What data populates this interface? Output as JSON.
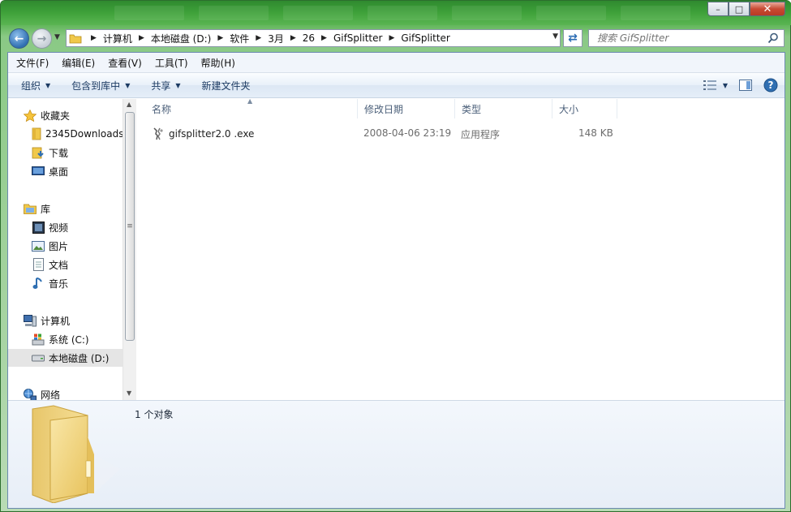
{
  "window": {
    "title_tabs": [
      "",
      "",
      "",
      "",
      "",
      "",
      ""
    ],
    "controls": {
      "minimize": "–",
      "maximize": "□",
      "close": "✕"
    }
  },
  "nav": {
    "back_icon": "back-arrow-icon",
    "forward_icon": "forward-arrow-icon",
    "breadcrumb": [
      "计算机",
      "本地磁盘 (D:)",
      "软件",
      "3月",
      "26",
      "GifSplitter",
      "GifSplitter"
    ],
    "search_placeholder": "搜索 GifSplitter"
  },
  "menubar": [
    "文件(F)",
    "编辑(E)",
    "查看(V)",
    "工具(T)",
    "帮助(H)"
  ],
  "toolbar": {
    "organize": "组织",
    "include_library": "包含到库中",
    "share": "共享",
    "new_folder": "新建文件夹"
  },
  "sidebar": {
    "favorites": {
      "label": "收藏夹",
      "items": [
        "2345Downloads",
        "下载",
        "桌面"
      ]
    },
    "libraries": {
      "label": "库",
      "items": [
        "视频",
        "图片",
        "文档",
        "音乐"
      ]
    },
    "computer": {
      "label": "计算机",
      "items": [
        "系统 (C:)",
        "本地磁盘 (D:)"
      ]
    },
    "network": {
      "label": "网络"
    }
  },
  "columns": {
    "name": "名称",
    "modified": "修改日期",
    "type": "类型",
    "size": "大小"
  },
  "files": [
    {
      "name": "gifsplitter2.0 .exe",
      "modified": "2008-04-06 23:19",
      "type": "应用程序",
      "size": "148 KB"
    }
  ],
  "status": {
    "count": "1 个对象"
  },
  "colors": {
    "frame_green": "#3fa23a",
    "toolbar_text": "#1c3b63",
    "header_text": "#4c607a",
    "selection": "#e5e5e5"
  }
}
